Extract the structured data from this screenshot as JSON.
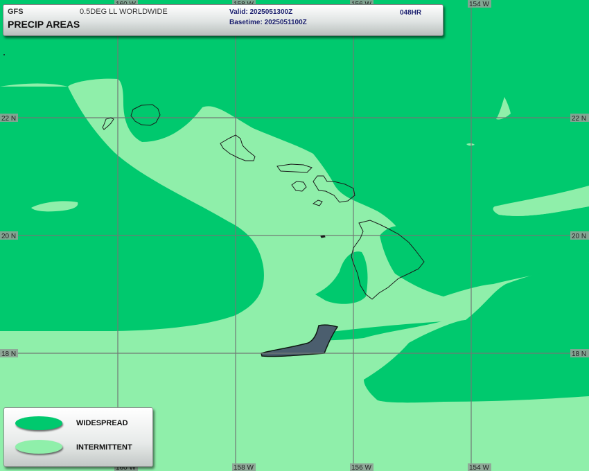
{
  "header": {
    "model": "GFS",
    "product": "0.5DEG LL WORLDWIDE",
    "title": "PRECIP AREAS",
    "valid": "Valid: 2025051300Z",
    "basetime": "Basetime: 2025051100Z",
    "forecast_hour": "048HR"
  },
  "legend": {
    "items": [
      {
        "label": "WIDESPREAD",
        "color": "#00c96e"
      },
      {
        "label": "INTERMITTENT",
        "color": "#8fefaa"
      }
    ]
  },
  "grid": {
    "lat_labels": [
      "22 N",
      "22 N",
      "20 N",
      "20 N",
      "18 N",
      "18 N"
    ],
    "lon_labels_top": [
      "160 W",
      "158 W",
      "156 W",
      "154 W"
    ],
    "lon_labels_bottom": [
      "160 W",
      "158 W",
      "156 W",
      "154 W"
    ]
  },
  "colors": {
    "widespread": "#00c96e",
    "intermittent": "#8fefaa",
    "other_precip": "#4b5e6e",
    "grid": "#707a74",
    "coastline": "#1a1a1a"
  }
}
